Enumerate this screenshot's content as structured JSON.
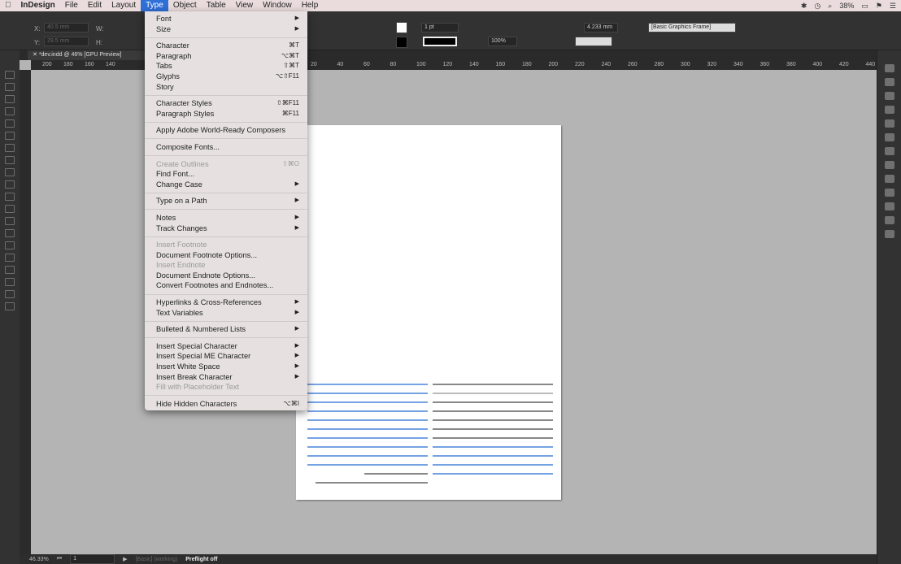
{
  "menubar": {
    "apple": "",
    "app": "InDesign",
    "items": [
      "File",
      "Edit",
      "Layout",
      "Type",
      "Object",
      "Table",
      "View",
      "Window",
      "Help"
    ],
    "battery": "38%"
  },
  "control": {
    "x_label": "X:",
    "y_label": "Y:",
    "w_label": "W:",
    "h_label": "H:",
    "x_value": "40.5 mm",
    "y_value": "29.5 mm",
    "stroke_weight": "1 pt",
    "opacity": "100%",
    "spacing": "4.233 mm",
    "object_style": "[Basic Graphics Frame]"
  },
  "document_tab": {
    "title": "*dev.indd @ 46% [GPU Preview]"
  },
  "ruler_labels": [
    "200",
    "180",
    "160",
    "140",
    "20",
    "40",
    "60",
    "80",
    "100",
    "120",
    "140",
    "160",
    "180",
    "200",
    "220",
    "240",
    "260",
    "280",
    "300",
    "320",
    "340",
    "360",
    "380",
    "400",
    "420",
    "440"
  ],
  "status": {
    "zoom": "46.33%",
    "page": "1",
    "style": "[Basic] (working)",
    "preflight": "Preflight off"
  },
  "type_menu": [
    {
      "label": "Font",
      "sub": true
    },
    {
      "label": "Size",
      "sub": true
    },
    {
      "sep": true
    },
    {
      "label": "Character",
      "shortcut": "⌘T"
    },
    {
      "label": "Paragraph",
      "shortcut": "⌥⌘T"
    },
    {
      "label": "Tabs",
      "shortcut": "⇧⌘T"
    },
    {
      "label": "Glyphs",
      "shortcut": "⌥⇧F11"
    },
    {
      "label": "Story"
    },
    {
      "sep": true
    },
    {
      "label": "Character Styles",
      "shortcut": "⇧⌘F11"
    },
    {
      "label": "Paragraph Styles",
      "shortcut": "⌘F11"
    },
    {
      "sep": true
    },
    {
      "label": "Apply Adobe World-Ready Composers"
    },
    {
      "sep": true
    },
    {
      "label": "Composite Fonts..."
    },
    {
      "sep": true
    },
    {
      "label": "Create Outlines",
      "shortcut": "⇧⌘O",
      "disabled": true
    },
    {
      "label": "Find Font..."
    },
    {
      "label": "Change Case",
      "sub": true
    },
    {
      "sep": true
    },
    {
      "label": "Type on a Path",
      "sub": true
    },
    {
      "sep": true
    },
    {
      "label": "Notes",
      "sub": true
    },
    {
      "label": "Track Changes",
      "sub": true
    },
    {
      "sep": true
    },
    {
      "label": "Insert Footnote",
      "disabled": true
    },
    {
      "label": "Document Footnote Options..."
    },
    {
      "label": "Insert Endnote",
      "disabled": true
    },
    {
      "label": "Document Endnote Options..."
    },
    {
      "label": "Convert Footnotes and Endnotes..."
    },
    {
      "sep": true
    },
    {
      "label": "Hyperlinks & Cross-References",
      "sub": true
    },
    {
      "label": "Text Variables",
      "sub": true
    },
    {
      "sep": true
    },
    {
      "label": "Bulleted & Numbered Lists",
      "sub": true
    },
    {
      "sep": true
    },
    {
      "label": "Insert Special Character",
      "sub": true
    },
    {
      "label": "Insert Special ME Character",
      "sub": true
    },
    {
      "label": "Insert White Space",
      "sub": true
    },
    {
      "label": "Insert Break Character",
      "sub": true
    },
    {
      "label": "Fill with Placeholder Text",
      "disabled": true
    },
    {
      "sep": true
    },
    {
      "label": "Hide Hidden Characters",
      "shortcut": "⌥⌘I"
    }
  ]
}
